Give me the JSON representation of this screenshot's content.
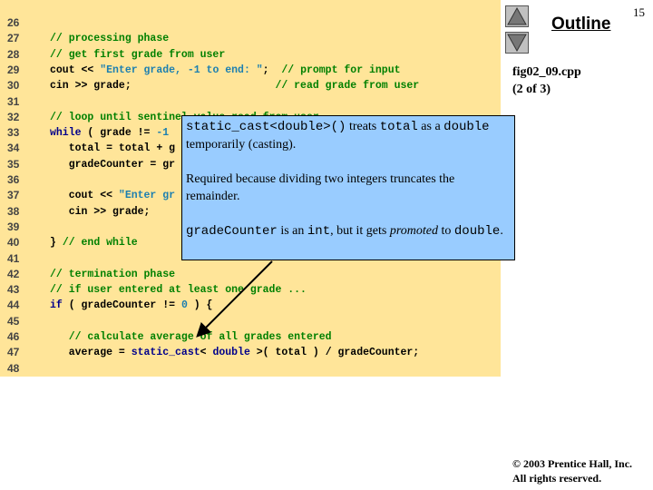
{
  "page_number": "15",
  "outline": {
    "title": "Outline",
    "file": "fig02_09.cpp",
    "part": "(2 of 3)",
    "nav": [
      "up-arrow-icon",
      "down-arrow-icon"
    ]
  },
  "code": [
    {
      "n": "26",
      "seg": []
    },
    {
      "n": "27",
      "seg": [
        [
          "c",
          "// processing phase"
        ]
      ]
    },
    {
      "n": "28",
      "seg": [
        [
          "c",
          "// get first grade from user"
        ]
      ]
    },
    {
      "n": "29",
      "seg": [
        [
          "p",
          "cout << "
        ],
        [
          "s",
          "\"Enter grade, -1 to end: \""
        ],
        [
          "p",
          ";  "
        ],
        [
          "c",
          "// prompt for input"
        ]
      ]
    },
    {
      "n": "30",
      "seg": [
        [
          "p",
          "cin >> grade;                       "
        ],
        [
          "c",
          "// read grade from user"
        ]
      ]
    },
    {
      "n": "31",
      "seg": []
    },
    {
      "n": "32",
      "seg": [
        [
          "c",
          "// loop until sentinel value read from user"
        ]
      ]
    },
    {
      "n": "33",
      "seg": [
        [
          "k",
          "while"
        ],
        [
          "p",
          " ( grade != "
        ],
        [
          "n",
          "-1"
        ]
      ]
    },
    {
      "n": "34",
      "seg": [
        [
          "p",
          "   total = total + g"
        ]
      ]
    },
    {
      "n": "35",
      "seg": [
        [
          "p",
          "   gradeCounter = gr"
        ]
      ]
    },
    {
      "n": "36",
      "seg": []
    },
    {
      "n": "37",
      "seg": [
        [
          "p",
          "   cout << "
        ],
        [
          "s",
          "\"Enter gr"
        ]
      ]
    },
    {
      "n": "38",
      "seg": [
        [
          "p",
          "   cin >> grade;"
        ]
      ]
    },
    {
      "n": "39",
      "seg": []
    },
    {
      "n": "40",
      "seg": [
        [
          "p",
          "} "
        ],
        [
          "c",
          "// end while"
        ]
      ]
    },
    {
      "n": "41",
      "seg": []
    },
    {
      "n": "42",
      "seg": [
        [
          "c",
          "// termination phase"
        ]
      ]
    },
    {
      "n": "43",
      "seg": [
        [
          "c",
          "// if user entered at least one grade ..."
        ]
      ]
    },
    {
      "n": "44",
      "seg": [
        [
          "k",
          "if"
        ],
        [
          "p",
          " ( gradeCounter != "
        ],
        [
          "n",
          "0"
        ],
        [
          "p",
          " ) {"
        ]
      ]
    },
    {
      "n": "45",
      "seg": []
    },
    {
      "n": "46",
      "seg": [
        [
          "c",
          "   // calculate average of all grades entered"
        ]
      ]
    },
    {
      "n": "47",
      "seg": [
        [
          "p",
          "   average = "
        ],
        [
          "k",
          "static_cast"
        ],
        [
          "p",
          "< "
        ],
        [
          "k",
          "double"
        ],
        [
          "p",
          " >( total ) / gradeCounter;"
        ]
      ]
    },
    {
      "n": "48",
      "seg": []
    }
  ],
  "callout": {
    "p1": {
      "a": "static_cast<double>()",
      "b": " treats ",
      "c": "total",
      "d": " as a ",
      "e": "double",
      "f": " temporarily (casting)."
    },
    "p2": "Required because dividing two integers truncates the remainder.",
    "p3": {
      "a": "gradeCounter",
      "b": " is an ",
      "c": "int",
      "d": ", but it gets ",
      "e": "promoted",
      "f": " to ",
      "g": "double",
      "h": "."
    }
  },
  "copyright": {
    "line1": "© 2003 Prentice Hall, Inc.",
    "line2": "All rights reserved."
  },
  "colors": {
    "code_bg": "#ffe599",
    "callout_bg": "#99ccff",
    "comment": "#008000",
    "keyword": "#00008b"
  }
}
